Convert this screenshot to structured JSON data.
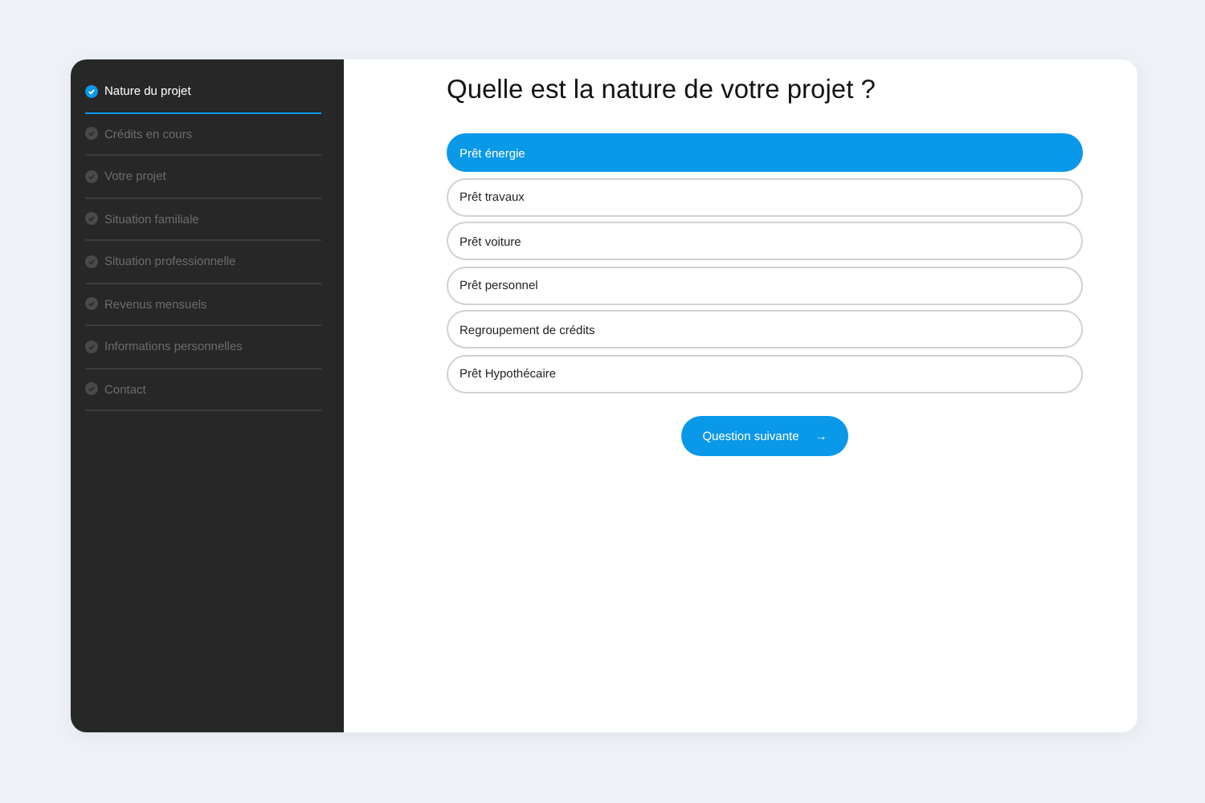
{
  "sidebar": {
    "steps": [
      {
        "label": "Nature du projet",
        "selected": true
      },
      {
        "label": "Crédits en cours",
        "selected": false
      },
      {
        "label": "Votre projet",
        "selected": false
      },
      {
        "label": "Situation familiale",
        "selected": false
      },
      {
        "label": "Situation professionnelle",
        "selected": false
      },
      {
        "label": "Revenus mensuels",
        "selected": false
      },
      {
        "label": "Informations personnelles",
        "selected": false
      },
      {
        "label": "Contact",
        "selected": false
      }
    ]
  },
  "question": {
    "title": "Quelle est la nature de votre projet ?",
    "options": [
      {
        "label": "Prêt énergie",
        "selected": true
      },
      {
        "label": "Prêt travaux",
        "selected": false
      },
      {
        "label": "Prêt voiture",
        "selected": false
      },
      {
        "label": "Prêt personnel",
        "selected": false
      },
      {
        "label": "Regroupement de crédits",
        "selected": false
      },
      {
        "label": "Prêt Hypothécaire",
        "selected": false
      }
    ],
    "next_button": {
      "label": "Question suivante",
      "arrow": "→"
    }
  }
}
